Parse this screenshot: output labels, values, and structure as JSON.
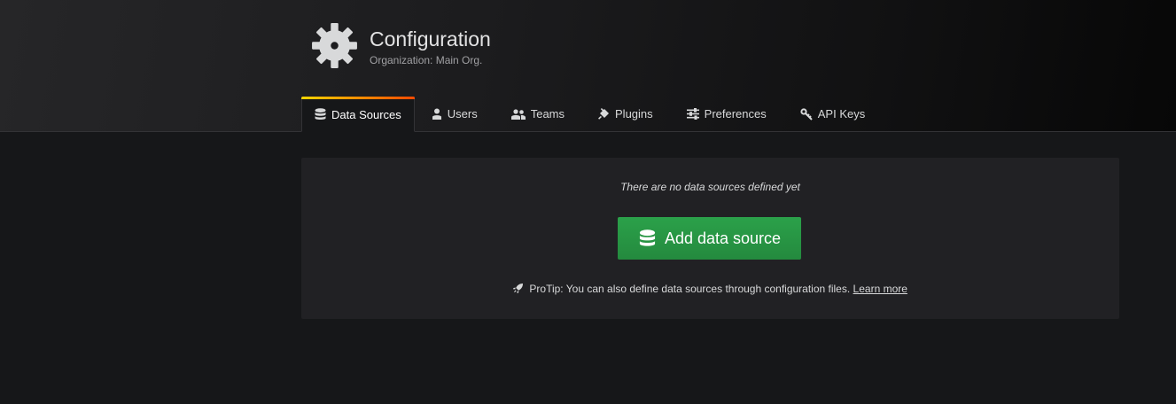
{
  "header": {
    "title": "Configuration",
    "subtitle": "Organization: Main Org.",
    "icon": "gear-icon"
  },
  "tabs": [
    {
      "label": "Data Sources",
      "icon": "database-icon",
      "active": true
    },
    {
      "label": "Users",
      "icon": "user-icon",
      "active": false
    },
    {
      "label": "Teams",
      "icon": "users-icon",
      "active": false
    },
    {
      "label": "Plugins",
      "icon": "plug-icon",
      "active": false
    },
    {
      "label": "Preferences",
      "icon": "sliders-icon",
      "active": false
    },
    {
      "label": "API Keys",
      "icon": "key-icon",
      "active": false
    }
  ],
  "empty_state": {
    "message": "There are no data sources defined yet",
    "button_label": "Add data source",
    "button_icon": "database-icon",
    "protip_icon": "rocket-icon",
    "protip_text": "ProTip: You can also define data sources through configuration files.",
    "learn_more_label": "Learn more"
  },
  "colors": {
    "accent_gradient_start": "#ffd500",
    "accent_gradient_end": "#ff4a00",
    "primary_button": "#299c46"
  }
}
